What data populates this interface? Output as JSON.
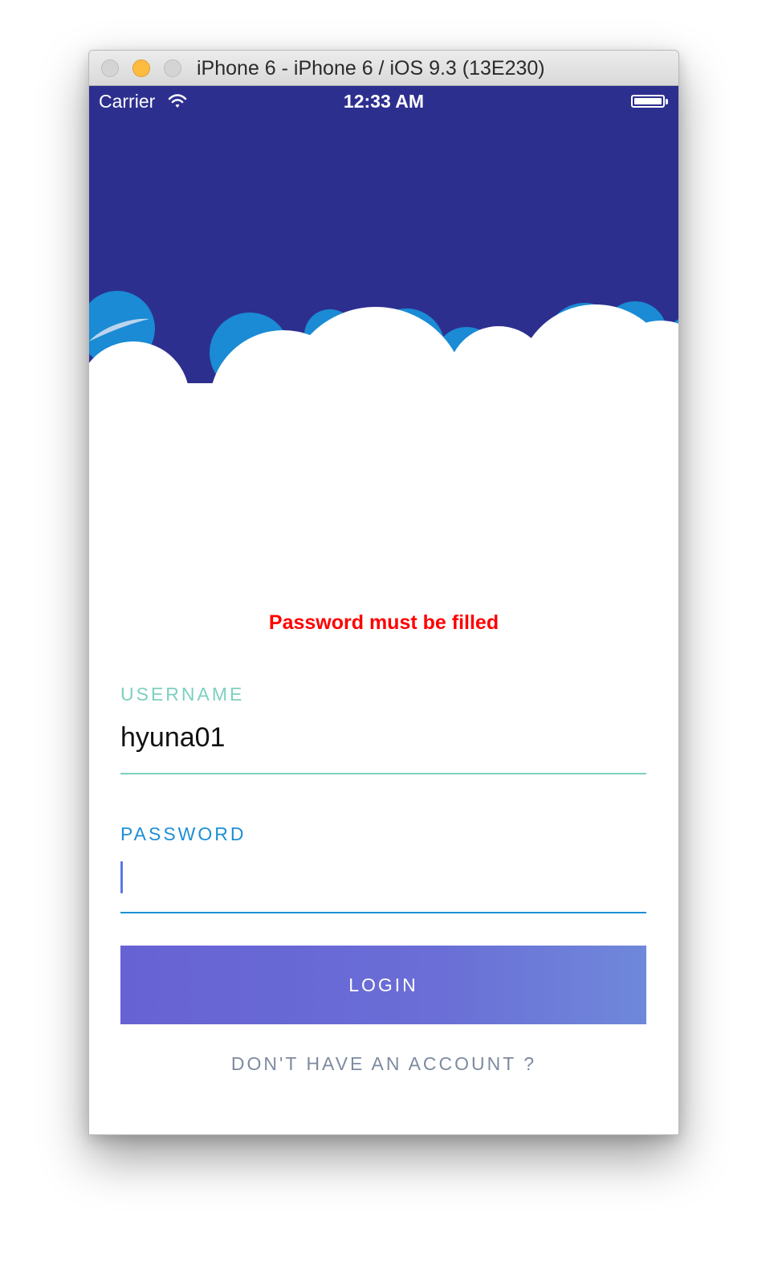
{
  "window": {
    "title": "iPhone 6 - iPhone 6 / iOS 9.3 (13E230)"
  },
  "status_bar": {
    "carrier": "Carrier",
    "time": "12:33 AM"
  },
  "colors": {
    "header_background": "#2d2f8f",
    "cloud_blue": "#1a8bd4",
    "error": "#ff0000",
    "username_accent": "#7dd0c0",
    "password_accent": "#1d8fd3",
    "button_gradient_start": "#6762d4",
    "button_gradient_end": "#6f88da"
  },
  "form": {
    "error_message": "Password must be filled",
    "username_label": "USERNAME",
    "username_value": "hyuna01",
    "password_label": "PASSWORD",
    "password_value": "",
    "login_button": "LOGIN",
    "signup_link": "DON'T HAVE AN ACCOUNT ?"
  }
}
